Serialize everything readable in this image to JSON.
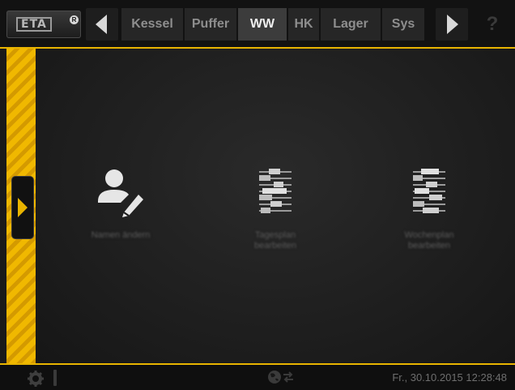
{
  "header": {
    "logo": "ETA",
    "tabs": [
      {
        "label": "Kessel",
        "active": false
      },
      {
        "label": "Puffer",
        "active": false
      },
      {
        "label": "WW",
        "active": true
      },
      {
        "label": "HK",
        "active": false
      },
      {
        "label": "Lager",
        "active": false
      },
      {
        "label": "Sys",
        "active": false
      }
    ],
    "help": "?"
  },
  "colors": {
    "accent": "#e8b400",
    "bar": "#121212",
    "panel": "#222222"
  },
  "main": {
    "tiles": [
      {
        "icon": "user-edit-icon",
        "label": "Namen ändern"
      },
      {
        "icon": "sliders-icon",
        "label": "Tagesplan bearbeiten"
      },
      {
        "icon": "sliders-icon",
        "label": "Wochenplan bearbeiten"
      }
    ]
  },
  "footer": {
    "datetime": "Fr., 30.10.2015 12:28:48"
  }
}
